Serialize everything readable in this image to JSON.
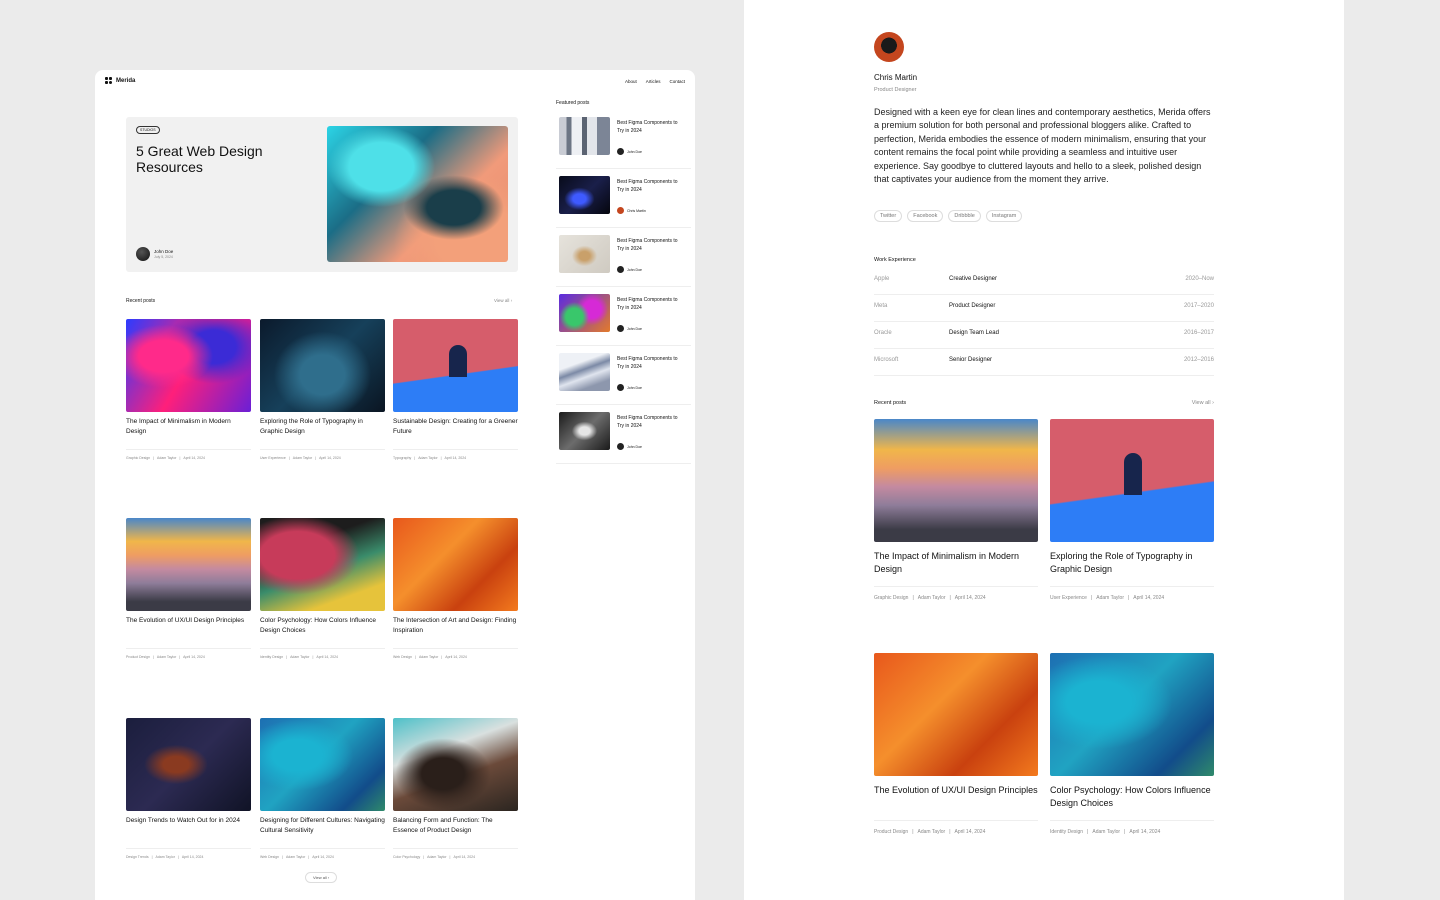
{
  "left": {
    "brand": "Merida",
    "nav": [
      "About",
      "Articles",
      "Contact"
    ],
    "hero": {
      "badge": "STUDIOS",
      "title": "5 Great Web Design Resources",
      "author": "John Doe",
      "date": "July 5, 2024"
    },
    "recent_heading": "Recent posts",
    "view_all": "View all",
    "posts": [
      {
        "title": "The Impact of Minimalism in Modern Design",
        "category": "Graphic Design",
        "author": "Adam Taylor",
        "date": "April 14, 2024",
        "image": "fluid-pink-blue"
      },
      {
        "title": "Exploring the Role of Typography in Graphic Design",
        "category": "User Experience",
        "author": "Adam Taylor",
        "date": "April 14, 2024",
        "image": "space-stars"
      },
      {
        "title": "Sustainable Design: Creating for a Greener Future",
        "category": "Typography",
        "author": "Adam Taylor",
        "date": "April 14, 2024",
        "image": "pink-arch"
      },
      {
        "title": "The Evolution of UX/UI Design Principles",
        "category": "Product Design",
        "author": "Adam Taylor",
        "date": "April 14, 2024",
        "image": "mountain-sunset"
      },
      {
        "title": "Color Psychology: How Colors Influence Design Choices",
        "category": "Identity Design",
        "author": "Adam Taylor",
        "date": "April 14, 2024",
        "image": "folded-colors"
      },
      {
        "title": "The Intersection of Art and Design: Finding Inspiration",
        "category": "Web Design",
        "author": "Adam Taylor",
        "date": "April 14, 2024",
        "image": "orange-paint"
      },
      {
        "title": "Design Trends to Watch Out for in 2024",
        "category": "Design Trends",
        "author": "Adam Taylor",
        "date": "April 14, 2024",
        "image": "dark-paint"
      },
      {
        "title": "Designing for Different Cultures: Navigating Cultural Sensitivity",
        "category": "Web Design",
        "author": "Adam Taylor",
        "date": "April 14, 2024",
        "image": "teal-paint"
      },
      {
        "title": "Balancing Form and Function: The Essence of Product Design",
        "category": "Color Psychology",
        "author": "Adam Taylor",
        "date": "April 14, 2024",
        "image": "rock-paint"
      }
    ],
    "featured_heading": "Featured posts",
    "featured": [
      {
        "title": "Best Figma Components to Try in 2024",
        "author": "John Doe",
        "image": "pillars"
      },
      {
        "title": "Best Figma Components to Try in 2024",
        "author": "Chris Martin",
        "image": "car"
      },
      {
        "title": "Best Figma Components to Try in 2024",
        "author": "John Doe",
        "image": "chair"
      },
      {
        "title": "Best Figma Components to Try in 2024",
        "author": "John Doe",
        "image": "blobs"
      },
      {
        "title": "Best Figma Components to Try in 2024",
        "author": "John Doe",
        "image": "wave"
      },
      {
        "title": "Best Figma Components to Try in 2024",
        "author": "John Doe",
        "image": "silver"
      }
    ],
    "footer_view_all": "View all"
  },
  "right": {
    "name": "Chris Martin",
    "role": "Product Designer",
    "bio": "Designed with a keen eye for clean lines and contemporary aesthetics, Merida offers a premium solution for both personal and professional bloggers alike. Crafted to perfection, Merida embodies the essence of modern minimalism, ensuring that your content remains the focal point while providing a seamless and intuitive user experience. Say goodbye to cluttered layouts and hello to a sleek, polished design that captivates your audience from the moment they arrive.",
    "socials": [
      "Twitter",
      "Facebook",
      "Dribbble",
      "Instagram"
    ],
    "experience_heading": "Work Experience",
    "experience": [
      {
        "company": "Apple",
        "role": "Creative Designer",
        "years": "2020–Now"
      },
      {
        "company": "Meta",
        "role": "Product Designer",
        "years": "2017–2020"
      },
      {
        "company": "Oracle",
        "role": "Design Team Lead",
        "years": "2016–2017"
      },
      {
        "company": "Microsoft",
        "role": "Senior Designer",
        "years": "2012–2016"
      }
    ],
    "recent_heading": "Recent posts",
    "view_all": "View all",
    "posts": [
      {
        "title": "The Impact of Minimalism in Modern Design",
        "category": "Graphic Design",
        "author": "Adam Taylor",
        "date": "April 14, 2024",
        "image": "mountain-sunset"
      },
      {
        "title": "Exploring the Role of Typography in Graphic Design",
        "category": "User Experience",
        "author": "Adam Taylor",
        "date": "April 14, 2024",
        "image": "pink-arch"
      },
      {
        "title": "The Evolution of UX/UI Design Principles",
        "category": "Product Design",
        "author": "Adam Taylor",
        "date": "April 14, 2024",
        "image": "orange-paint"
      },
      {
        "title": "Color Psychology: How Colors Influence Design Choices",
        "category": "Identity Design",
        "author": "Adam Taylor",
        "date": "April 14, 2024",
        "image": "teal-paint"
      }
    ]
  }
}
